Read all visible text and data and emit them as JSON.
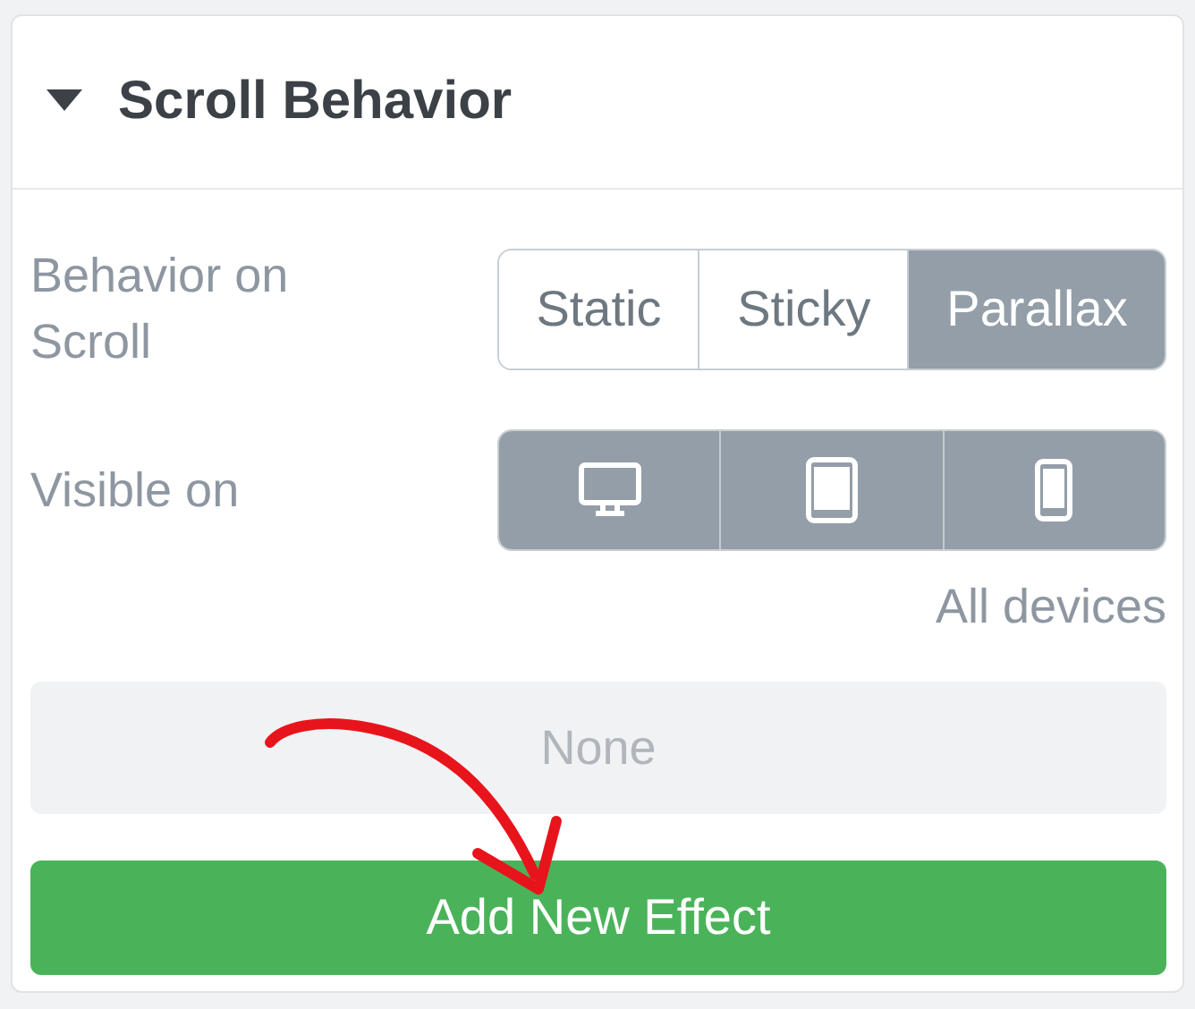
{
  "section": {
    "title": "Scroll Behavior",
    "expanded": true
  },
  "behavior": {
    "label": "Behavior on Scroll",
    "options": [
      {
        "label": "Static",
        "selected": false
      },
      {
        "label": "Sticky",
        "selected": false
      },
      {
        "label": "Parallax",
        "selected": true
      }
    ]
  },
  "visibility": {
    "label": "Visible on",
    "devices": [
      {
        "kind": "desktop",
        "selected": true
      },
      {
        "kind": "tablet",
        "selected": true
      },
      {
        "kind": "mobile",
        "selected": true
      }
    ],
    "summary": "All devices"
  },
  "effects": {
    "empty_text": "None"
  },
  "add_button": "Add New Effect"
}
